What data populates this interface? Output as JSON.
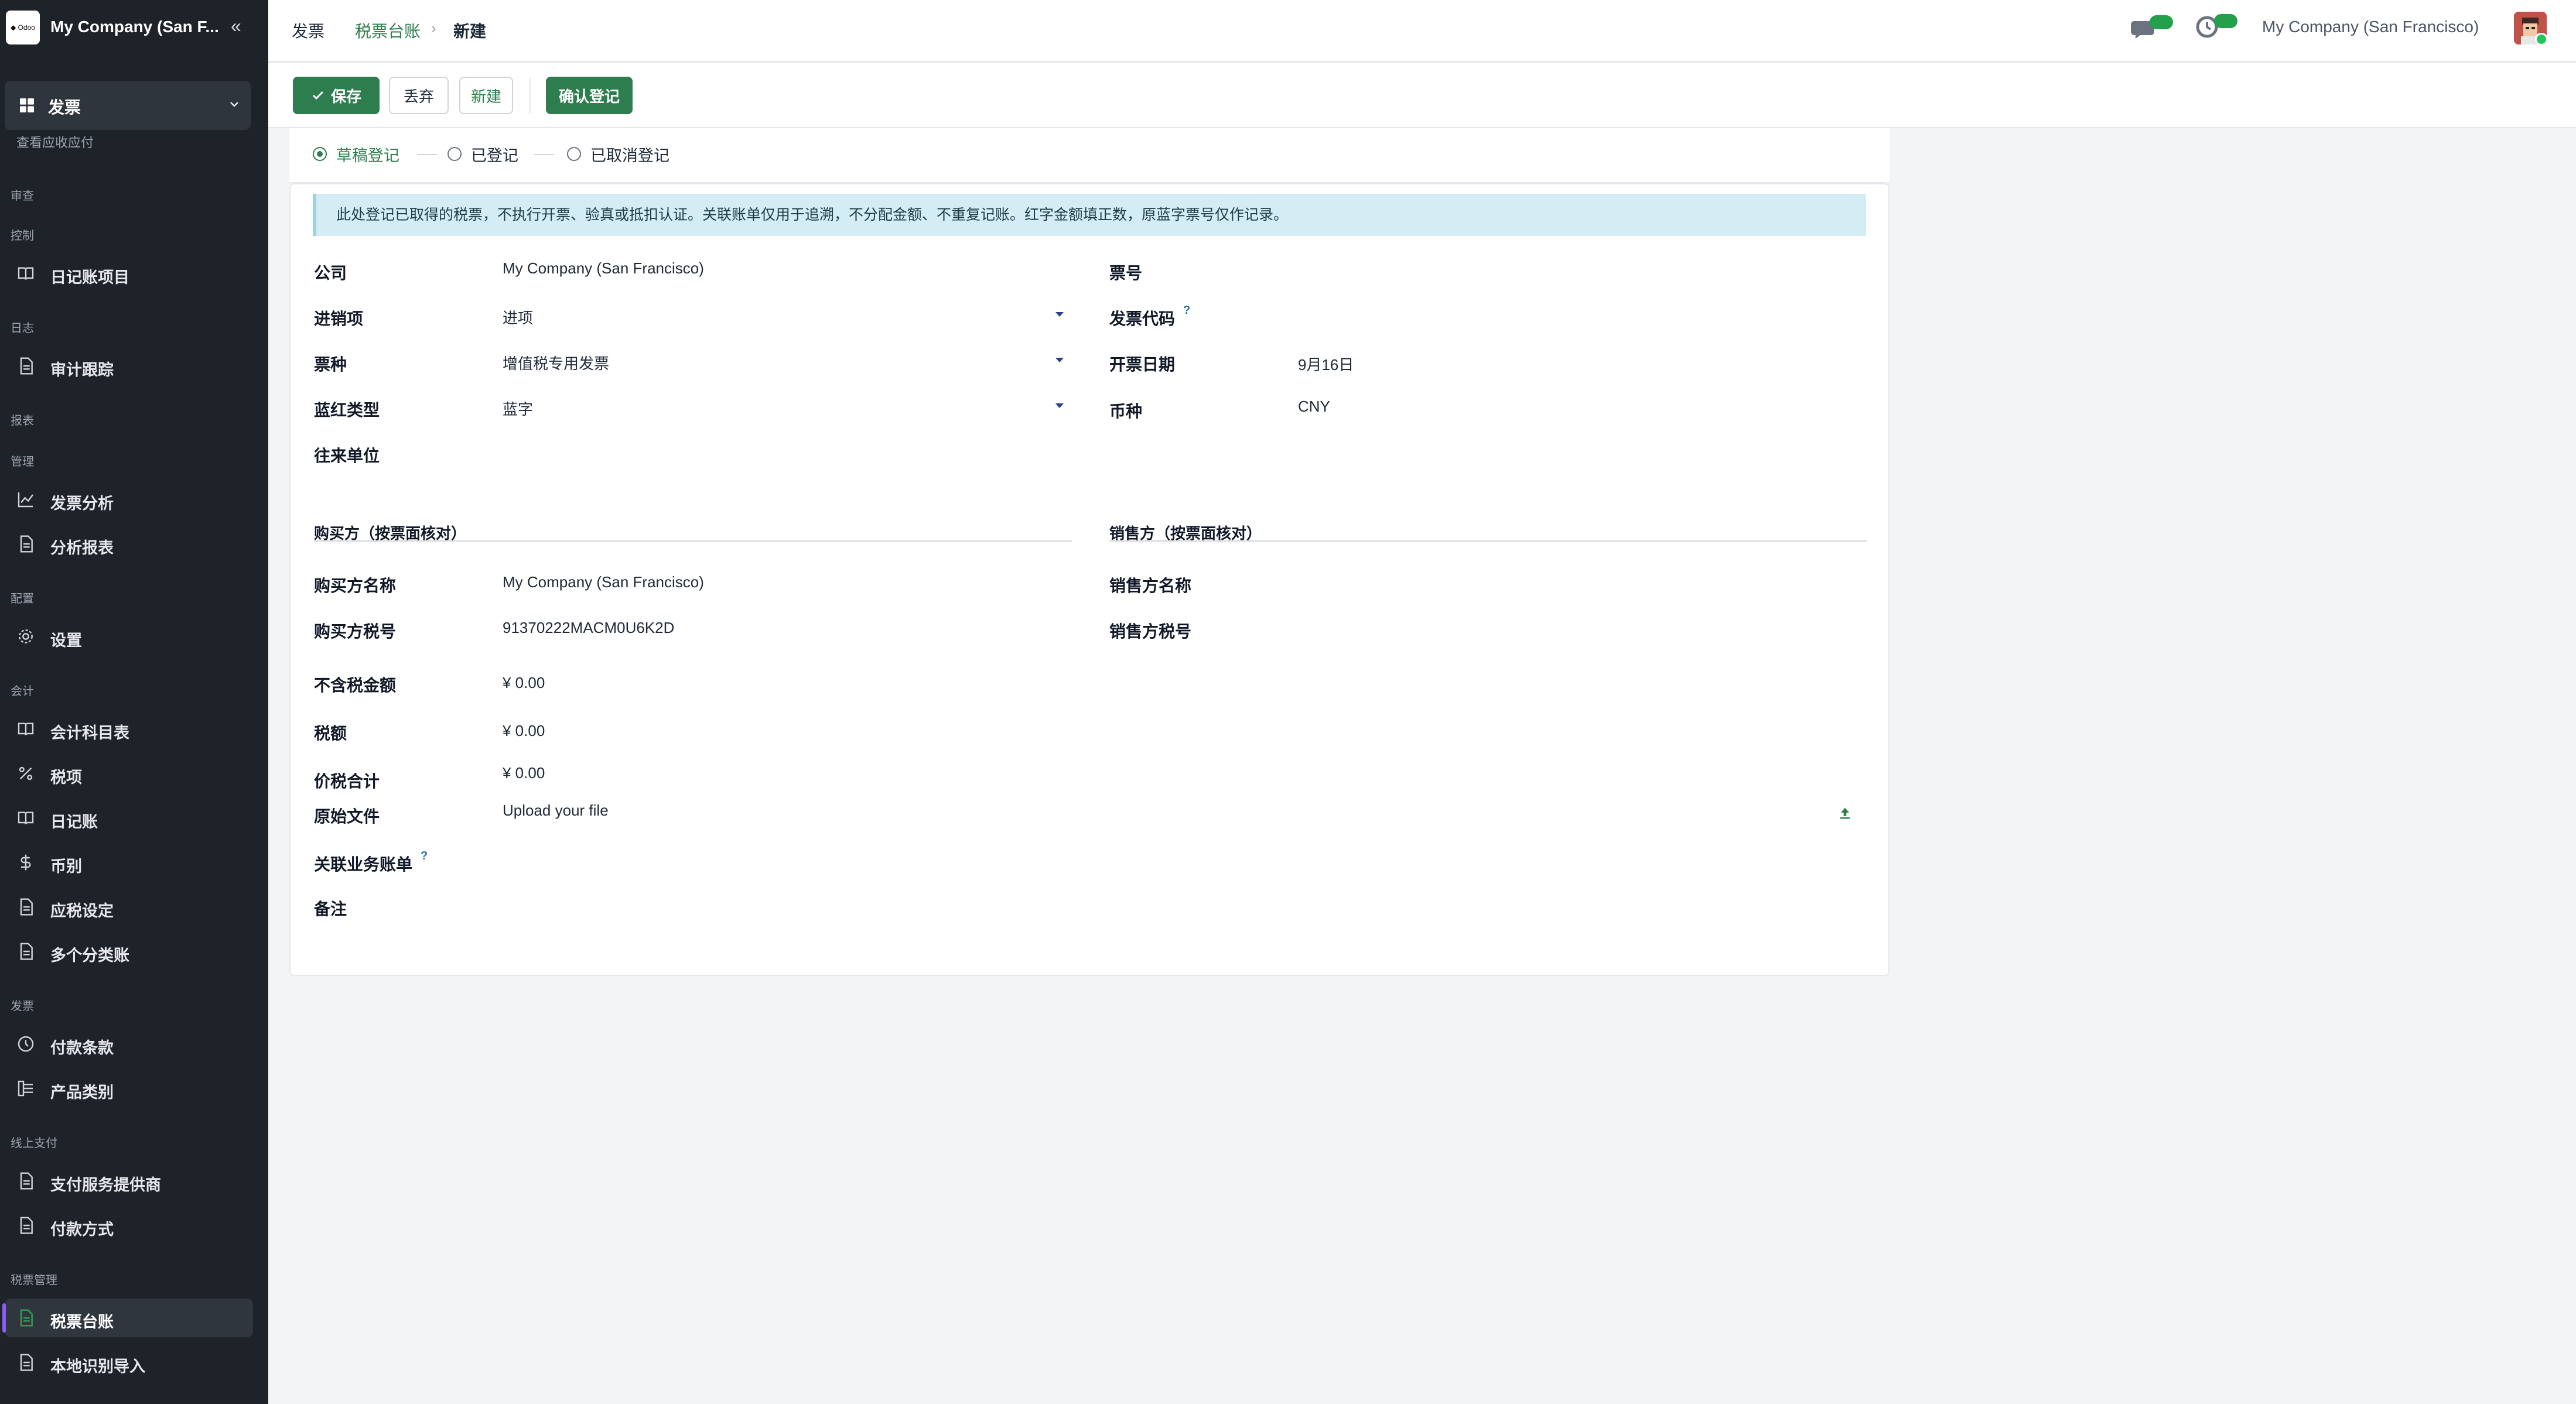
{
  "sidebar": {
    "logo_text": "◆ Odoo",
    "company": "My Company (San F...",
    "collapse_icon": "«",
    "app_label": "发票",
    "cut_off_label": "查看应收应付",
    "groups": [
      {
        "title": "审查"
      },
      {
        "title": "控制",
        "items": [
          {
            "label": "日记账项目",
            "icon": "book-icon"
          }
        ]
      },
      {
        "title": "日志",
        "items": [
          {
            "label": "审计跟踪",
            "icon": "document-icon"
          }
        ]
      },
      {
        "title": "报表"
      },
      {
        "title": "管理",
        "items": [
          {
            "label": "发票分析",
            "icon": "line-chart-icon"
          },
          {
            "label": "分析报表",
            "icon": "document-icon"
          }
        ]
      },
      {
        "title": "配置",
        "items": [
          {
            "label": "设置",
            "icon": "gear-icon"
          }
        ]
      },
      {
        "title": "会计",
        "items": [
          {
            "label": "会计科目表",
            "icon": "book-icon"
          },
          {
            "label": "税项",
            "icon": "percent-icon"
          },
          {
            "label": "日记账",
            "icon": "book-icon"
          },
          {
            "label": "币别",
            "icon": "dollar-icon"
          },
          {
            "label": "应税设定",
            "icon": "document-icon"
          },
          {
            "label": "多个分类账",
            "icon": "document-icon"
          }
        ]
      },
      {
        "title": "发票",
        "items": [
          {
            "label": "付款条款",
            "icon": "clock-icon"
          },
          {
            "label": "产品类别",
            "icon": "hierarchy-icon"
          }
        ]
      },
      {
        "title": "线上支付",
        "items": [
          {
            "label": "支付服务提供商",
            "icon": "document-icon"
          },
          {
            "label": "付款方式",
            "icon": "document-icon"
          }
        ]
      },
      {
        "title": "税票管理",
        "items": [
          {
            "label": "税票台账",
            "icon": "document-icon",
            "active": true
          },
          {
            "label": "本地识别导入",
            "icon": "document-icon"
          }
        ]
      }
    ]
  },
  "topbar": {
    "breadcrumb": [
      "发票",
      "税票台账",
      "新建"
    ],
    "breadcrumb_sep": "›",
    "company": "My Company (San Francisco)"
  },
  "toolbar": {
    "save": "保存",
    "discard": "丢弃",
    "new": "新建",
    "confirm": "确认登记"
  },
  "statusbar": {
    "states": [
      {
        "label": "草稿登记",
        "selected": true
      },
      {
        "label": "已登记",
        "selected": false
      },
      {
        "label": "已取消登记",
        "selected": false
      }
    ]
  },
  "form": {
    "alert": "此处登记已取得的税票，不执行开票、验真或抵扣认证。关联账单仅用于追溯，不分配金额、不重复记账。红字金额填正数，原蓝字票号仅作记录。",
    "company": {
      "label": "公司",
      "value": "My Company (San Francisco)"
    },
    "direction": {
      "label": "进销项",
      "value": "进项"
    },
    "invoice_type": {
      "label": "票种",
      "value": "增值税专用发票"
    },
    "color_type": {
      "label": "蓝红类型",
      "value": "蓝字"
    },
    "partner": {
      "label": "往来单位",
      "value": ""
    },
    "invoice_number": {
      "label": "票号",
      "value": ""
    },
    "invoice_code": {
      "label": "发票代码",
      "help": "?",
      "value": ""
    },
    "invoice_date": {
      "label": "开票日期",
      "value": "9月16日"
    },
    "currency": {
      "label": "币种",
      "value": "CNY"
    },
    "buyer_section": "购买方（按票面核对）",
    "seller_section": "销售方（按票面核对）",
    "buyer_name": {
      "label": "购买方名称",
      "value": "My Company (San Francisco)"
    },
    "buyer_tax_id": {
      "label": "购买方税号",
      "value": "91370222MACM0U6K2D"
    },
    "seller_name": {
      "label": "销售方名称",
      "value": ""
    },
    "seller_tax_id": {
      "label": "销售方税号",
      "value": ""
    },
    "amount_untaxed": {
      "label": "不含税金额",
      "value": "¥ 0.00"
    },
    "amount_tax": {
      "label": "税额",
      "value": "¥ 0.00"
    },
    "amount_total": {
      "label": "价税合计",
      "value": "¥ 0.00"
    },
    "original_file": {
      "label": "原始文件",
      "value": "Upload your file"
    },
    "related_bills": {
      "label": "关联业务账单",
      "help": "?"
    },
    "notes": {
      "label": "备注"
    }
  },
  "colors": {
    "brand_green": "#2e7d4f",
    "sidebar_bg": "#1e2329",
    "alert_bg": "#d4ecf3",
    "active_marker": "#8b5cf6"
  }
}
